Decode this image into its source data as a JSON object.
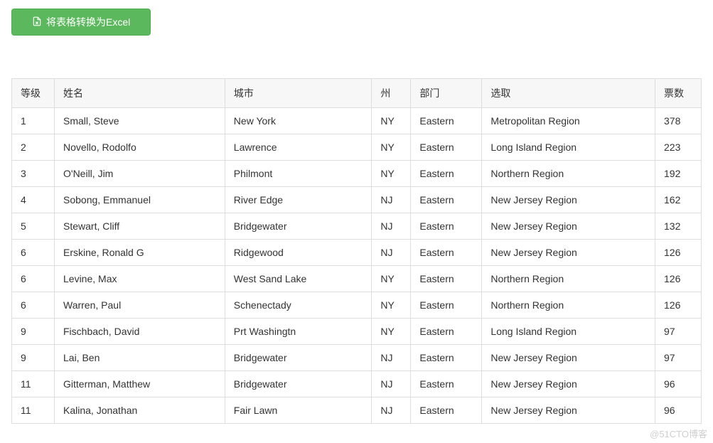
{
  "button": {
    "export_label": "将表格转换为Excel"
  },
  "table": {
    "headers": {
      "rank": "等级",
      "name": "姓名",
      "city": "城市",
      "state": "州",
      "dept": "部门",
      "region": "选取",
      "votes": "票数"
    },
    "rows": [
      {
        "rank": "1",
        "name": "Small, Steve",
        "city": "New York",
        "state": "NY",
        "dept": "Eastern",
        "region": "Metropolitan Region",
        "votes": "378"
      },
      {
        "rank": "2",
        "name": "Novello, Rodolfo",
        "city": "Lawrence",
        "state": "NY",
        "dept": "Eastern",
        "region": "Long Island Region",
        "votes": "223"
      },
      {
        "rank": "3",
        "name": "O'Neill, Jim",
        "city": "Philmont",
        "state": "NY",
        "dept": "Eastern",
        "region": "Northern Region",
        "votes": "192"
      },
      {
        "rank": "4",
        "name": "Sobong, Emmanuel",
        "city": "River Edge",
        "state": "NJ",
        "dept": "Eastern",
        "region": "New Jersey Region",
        "votes": "162"
      },
      {
        "rank": "5",
        "name": "Stewart, Cliff",
        "city": "Bridgewater",
        "state": "NJ",
        "dept": "Eastern",
        "region": "New Jersey Region",
        "votes": "132"
      },
      {
        "rank": "6",
        "name": "Erskine, Ronald G",
        "city": "Ridgewood",
        "state": "NJ",
        "dept": "Eastern",
        "region": "New Jersey Region",
        "votes": "126"
      },
      {
        "rank": "6",
        "name": "Levine, Max",
        "city": "West Sand Lake",
        "state": "NY",
        "dept": "Eastern",
        "region": "Northern Region",
        "votes": "126"
      },
      {
        "rank": "6",
        "name": "Warren, Paul",
        "city": "Schenectady",
        "state": "NY",
        "dept": "Eastern",
        "region": "Northern Region",
        "votes": "126"
      },
      {
        "rank": "9",
        "name": "Fischbach, David",
        "city": "Prt Washingtn",
        "state": "NY",
        "dept": "Eastern",
        "region": "Long Island Region",
        "votes": "97"
      },
      {
        "rank": "9",
        "name": "Lai, Ben",
        "city": "Bridgewater",
        "state": "NJ",
        "dept": "Eastern",
        "region": "New Jersey Region",
        "votes": "97"
      },
      {
        "rank": "11",
        "name": "Gitterman, Matthew",
        "city": "Bridgewater",
        "state": "NJ",
        "dept": "Eastern",
        "region": "New Jersey Region",
        "votes": "96"
      },
      {
        "rank": "11",
        "name": "Kalina, Jonathan",
        "city": "Fair Lawn",
        "state": "NJ",
        "dept": "Eastern",
        "region": "New Jersey Region",
        "votes": "96"
      }
    ]
  },
  "watermark": "@51CTO博客"
}
